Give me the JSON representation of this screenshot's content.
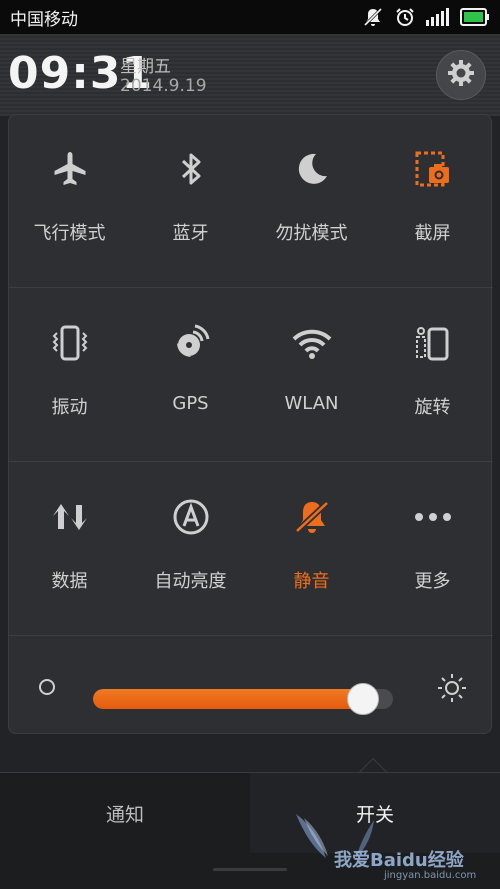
{
  "status_bar": {
    "carrier": "中国移动",
    "icons": [
      "mute-icon",
      "alarm-icon",
      "signal-icon",
      "battery-icon"
    ],
    "battery_color": "#2ec24a"
  },
  "header": {
    "time": "09:31",
    "weekday": "星期五",
    "date": "2014.9.19",
    "settings_icon": "gear-icon"
  },
  "toggles": [
    {
      "label": "飞行模式",
      "icon": "airplane-icon",
      "active": false
    },
    {
      "label": "蓝牙",
      "icon": "bluetooth-icon",
      "active": false
    },
    {
      "label": "勿扰模式",
      "icon": "moon-icon",
      "active": false
    },
    {
      "label": "截屏",
      "icon": "screenshot-icon",
      "active": false
    },
    {
      "label": "振动",
      "icon": "vibrate-icon",
      "active": false
    },
    {
      "label": "GPS",
      "icon": "gps-icon",
      "active": false
    },
    {
      "label": "WLAN",
      "icon": "wifi-icon",
      "active": false
    },
    {
      "label": "旋转",
      "icon": "rotate-icon",
      "active": false
    },
    {
      "label": "数据",
      "icon": "data-icon",
      "active": false
    },
    {
      "label": "自动亮度",
      "icon": "auto-brightness-icon",
      "active": false
    },
    {
      "label": "静音",
      "icon": "mute-bell-icon",
      "active": true
    },
    {
      "label": "更多",
      "icon": "more-icon",
      "active": false
    }
  ],
  "brightness": {
    "level": 0.9,
    "min_icon": "dim-icon",
    "max_icon": "brightness-icon"
  },
  "tabs": {
    "notifications": "通知",
    "switches": "开关"
  },
  "watermark": {
    "text": "我爱Baidu经验",
    "url": "jingyan.baidu.com"
  },
  "colors": {
    "accent": "#ee6d1d",
    "background": "#222326",
    "panel": "#2e2f32"
  }
}
